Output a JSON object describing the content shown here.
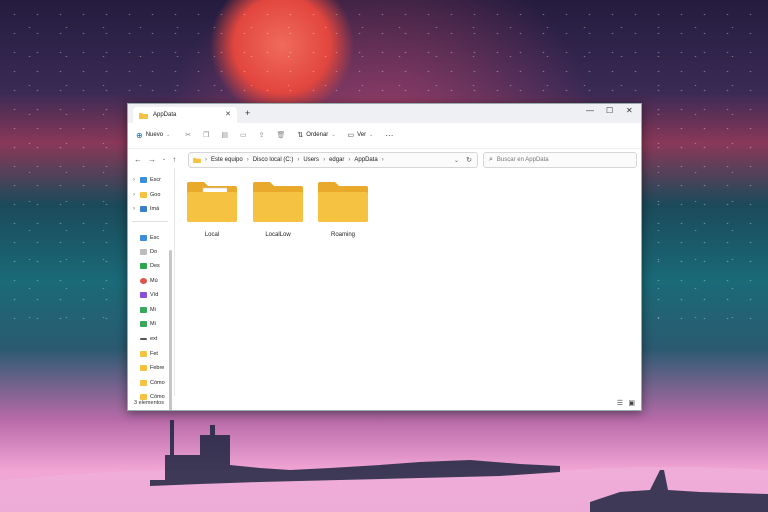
{
  "window": {
    "tab_title": "AppData",
    "tab_close": "✕",
    "new_tab": "+",
    "minimize": "—",
    "maximize": "☐",
    "close": "✕"
  },
  "toolbar": {
    "new_label": "Nuevo",
    "sort_label": "Ordenar",
    "view_label": "Ver",
    "more_label": "···"
  },
  "address": {
    "crumbs": [
      "Este equipo",
      "Disco local (C:)",
      "Users",
      "edgar",
      "AppData"
    ],
    "search_placeholder": "Buscar en AppData"
  },
  "sidebar": {
    "items": [
      "Escr",
      "Goo",
      "Imá",
      "Esc",
      "Do",
      "Des",
      "Mú",
      "Víd",
      "Mi",
      "Mi",
      "ext",
      "Fet",
      "Febre",
      "Cómo",
      "Cómo"
    ]
  },
  "folders": [
    {
      "name": "Local"
    },
    {
      "name": "LocalLow"
    },
    {
      "name": "Roaming"
    }
  ],
  "status": {
    "count": "3 elementos"
  },
  "colors": {
    "folder_yellow": "#f5c341",
    "accent_blue": "#0f6cbd"
  }
}
